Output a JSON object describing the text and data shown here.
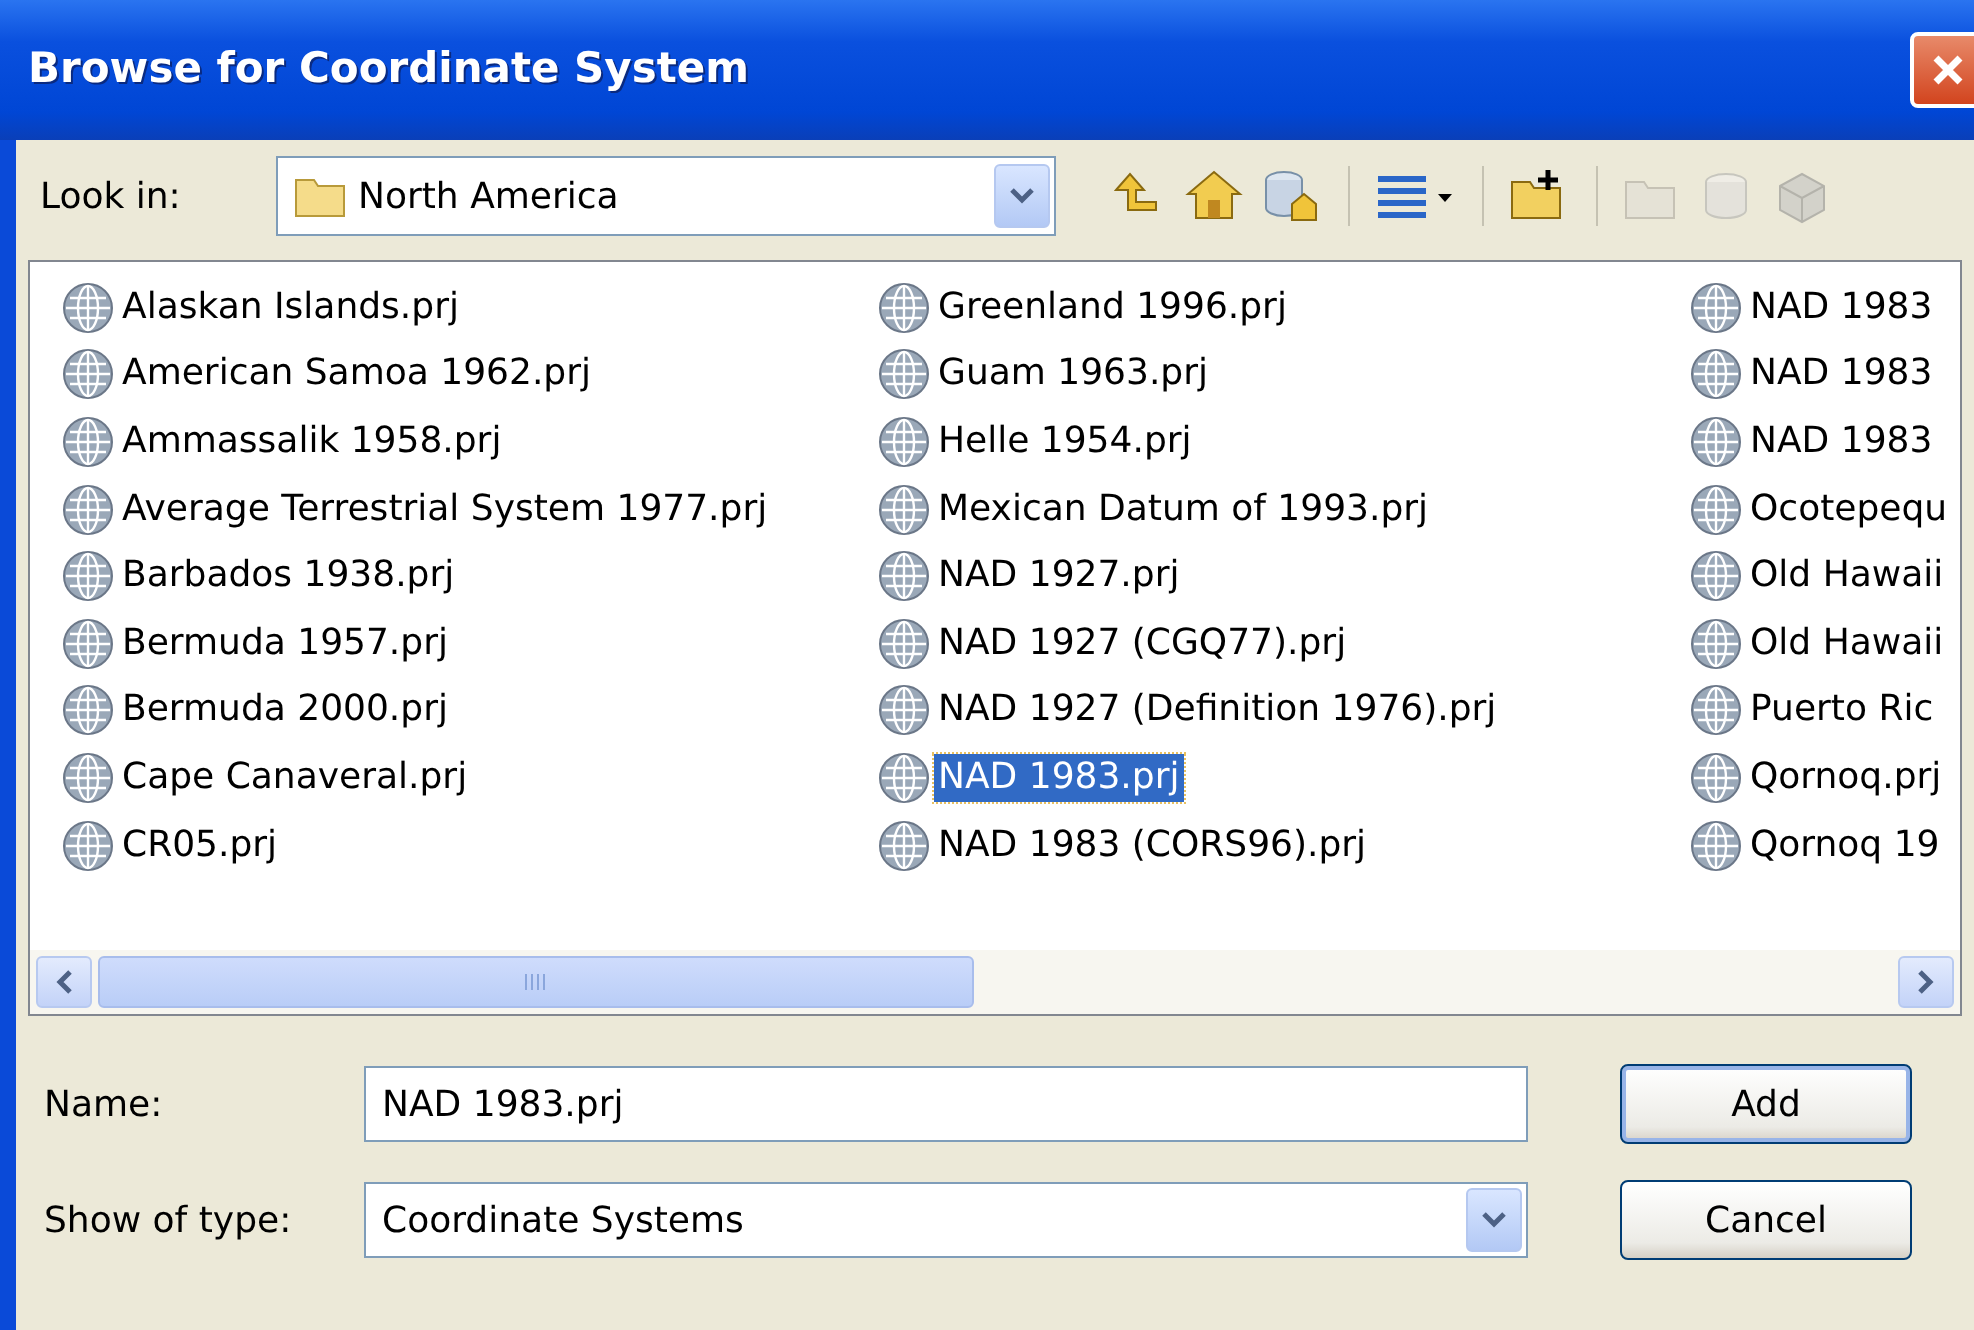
{
  "window": {
    "title": "Browse for Coordinate System"
  },
  "look_in": {
    "label": "Look in:",
    "value": "North America"
  },
  "toolbar": [
    {
      "kind": "up",
      "disabled": false
    },
    {
      "kind": "home",
      "disabled": false
    },
    {
      "kind": "database",
      "disabled": false
    },
    {
      "kind": "views",
      "disabled": false
    },
    {
      "kind": "connect",
      "disabled": false
    },
    {
      "kind": "folder",
      "disabled": true
    },
    {
      "kind": "cylinder",
      "disabled": true
    },
    {
      "kind": "toolbox",
      "disabled": true
    }
  ],
  "files": [
    {
      "label": "Alaskan Islands.prj",
      "selected": false
    },
    {
      "label": "American Samoa 1962.prj",
      "selected": false
    },
    {
      "label": "Ammassalik 1958.prj",
      "selected": false
    },
    {
      "label": "Average Terrestrial System 1977.prj",
      "selected": false
    },
    {
      "label": "Barbados 1938.prj",
      "selected": false
    },
    {
      "label": "Bermuda 1957.prj",
      "selected": false
    },
    {
      "label": "Bermuda 2000.prj",
      "selected": false
    },
    {
      "label": "Cape Canaveral.prj",
      "selected": false
    },
    {
      "label": "CR05.prj",
      "selected": false
    },
    {
      "label": "Greenland 1996.prj",
      "selected": false
    },
    {
      "label": "Guam 1963.prj",
      "selected": false
    },
    {
      "label": "Helle 1954.prj",
      "selected": false
    },
    {
      "label": "Mexican Datum of 1993.prj",
      "selected": false
    },
    {
      "label": "NAD 1927.prj",
      "selected": false
    },
    {
      "label": "NAD 1927 (CGQ77).prj",
      "selected": false
    },
    {
      "label": "NAD 1927 (Definition 1976).prj",
      "selected": false
    },
    {
      "label": "NAD 1983.prj",
      "selected": true
    },
    {
      "label": "NAD 1983 (CORS96).prj",
      "selected": false
    },
    {
      "label": "NAD 1983",
      "selected": false
    },
    {
      "label": "NAD 1983",
      "selected": false
    },
    {
      "label": "NAD 1983",
      "selected": false
    },
    {
      "label": "Ocotepequ",
      "selected": false
    },
    {
      "label": "Old Hawaii",
      "selected": false
    },
    {
      "label": "Old Hawaii",
      "selected": false
    },
    {
      "label": "Puerto Ric",
      "selected": false
    },
    {
      "label": "Qornoq.prj",
      "selected": false
    },
    {
      "label": "Qornoq 19",
      "selected": false
    }
  ],
  "name_field": {
    "label": "Name:",
    "value": "NAD 1983.prj"
  },
  "type_field": {
    "label": "Show of type:",
    "value": "Coordinate Systems"
  },
  "buttons": [
    {
      "label": "Add",
      "default": true
    },
    {
      "label": "Cancel",
      "default": false
    }
  ]
}
